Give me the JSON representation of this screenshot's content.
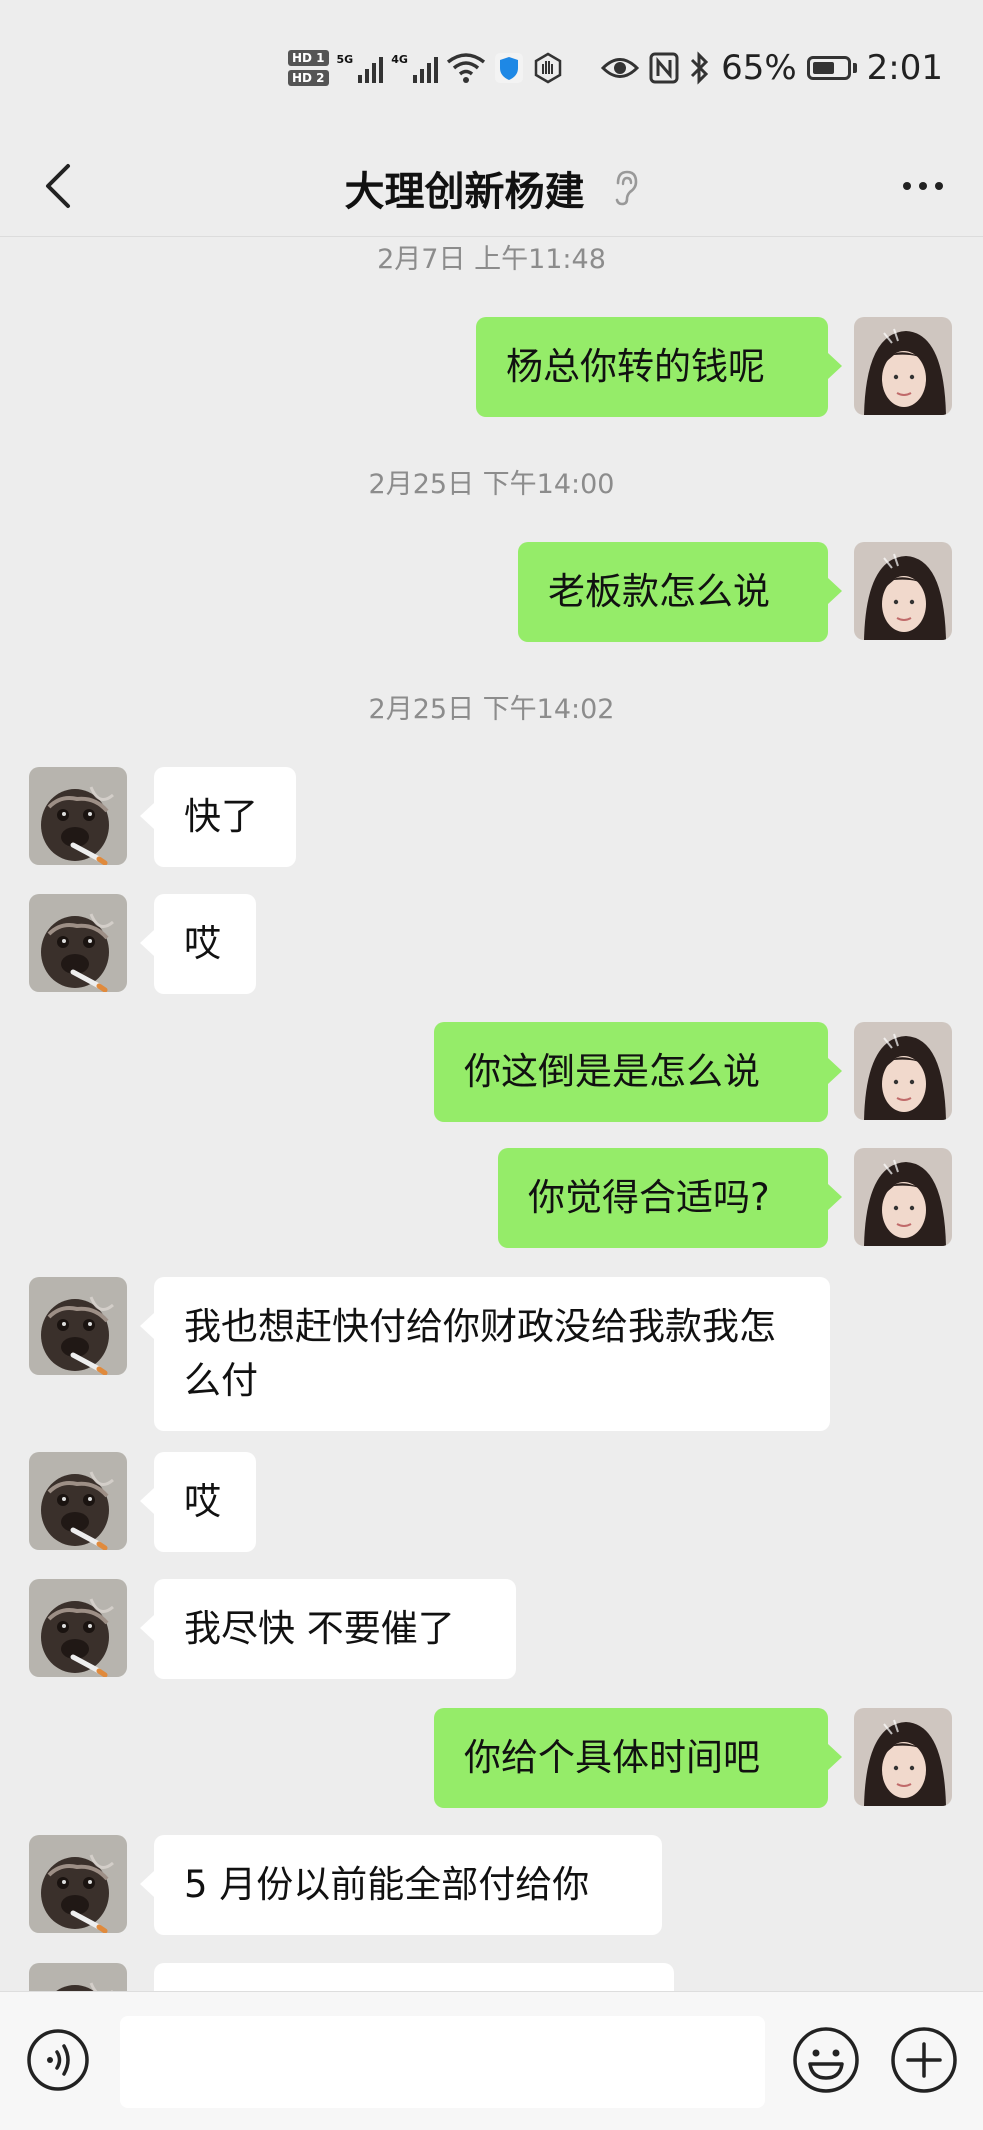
{
  "status_bar": {
    "hd1": "HD 1",
    "hd2": "HD 2",
    "sig1_label": "5G",
    "sig2_label": "4G",
    "battery": "65%",
    "battery_level": 0.65,
    "time": "2:01"
  },
  "header": {
    "title": "大理创新杨建"
  },
  "messages": [
    {
      "type": "timestamp",
      "text": "2月7日 上午11:48"
    },
    {
      "type": "message",
      "side": "out",
      "text": "杨总你转的钱呢"
    },
    {
      "type": "timestamp",
      "text": "2月25日 下午14:00"
    },
    {
      "type": "message",
      "side": "out",
      "text": "老板款怎么说"
    },
    {
      "type": "timestamp",
      "text": "2月25日 下午14:02"
    },
    {
      "type": "message",
      "side": "in",
      "text": "快了"
    },
    {
      "type": "message",
      "side": "in",
      "text": "哎"
    },
    {
      "type": "message",
      "side": "out",
      "text": "你这倒是是怎么说"
    },
    {
      "type": "message",
      "side": "out",
      "text": "你觉得合适吗?"
    },
    {
      "type": "message",
      "side": "in",
      "text": "我也想赶快付给你财政没给我款我怎么付"
    },
    {
      "type": "message",
      "side": "in",
      "text": "哎"
    },
    {
      "type": "message",
      "side": "in",
      "text": "我尽快 不要催了"
    },
    {
      "type": "message",
      "side": "out",
      "text": "你给个具体时间吧"
    },
    {
      "type": "message",
      "side": "in",
      "text": "5 月份以前能全部付给你"
    },
    {
      "type": "message",
      "side": "in",
      "text": ""
    }
  ],
  "input": {
    "value": ""
  },
  "colors": {
    "background": "#ededed",
    "outgoing_bubble": "#95ec69",
    "incoming_bubble": "#ffffff",
    "timestamp_text": "#8c8c8c"
  },
  "icons": {
    "back": "chevron-left-icon",
    "ear": "ear-icon",
    "more": "more-dots-icon",
    "voice": "voice-icon",
    "emoji": "emoji-icon",
    "plus": "plus-icon"
  }
}
